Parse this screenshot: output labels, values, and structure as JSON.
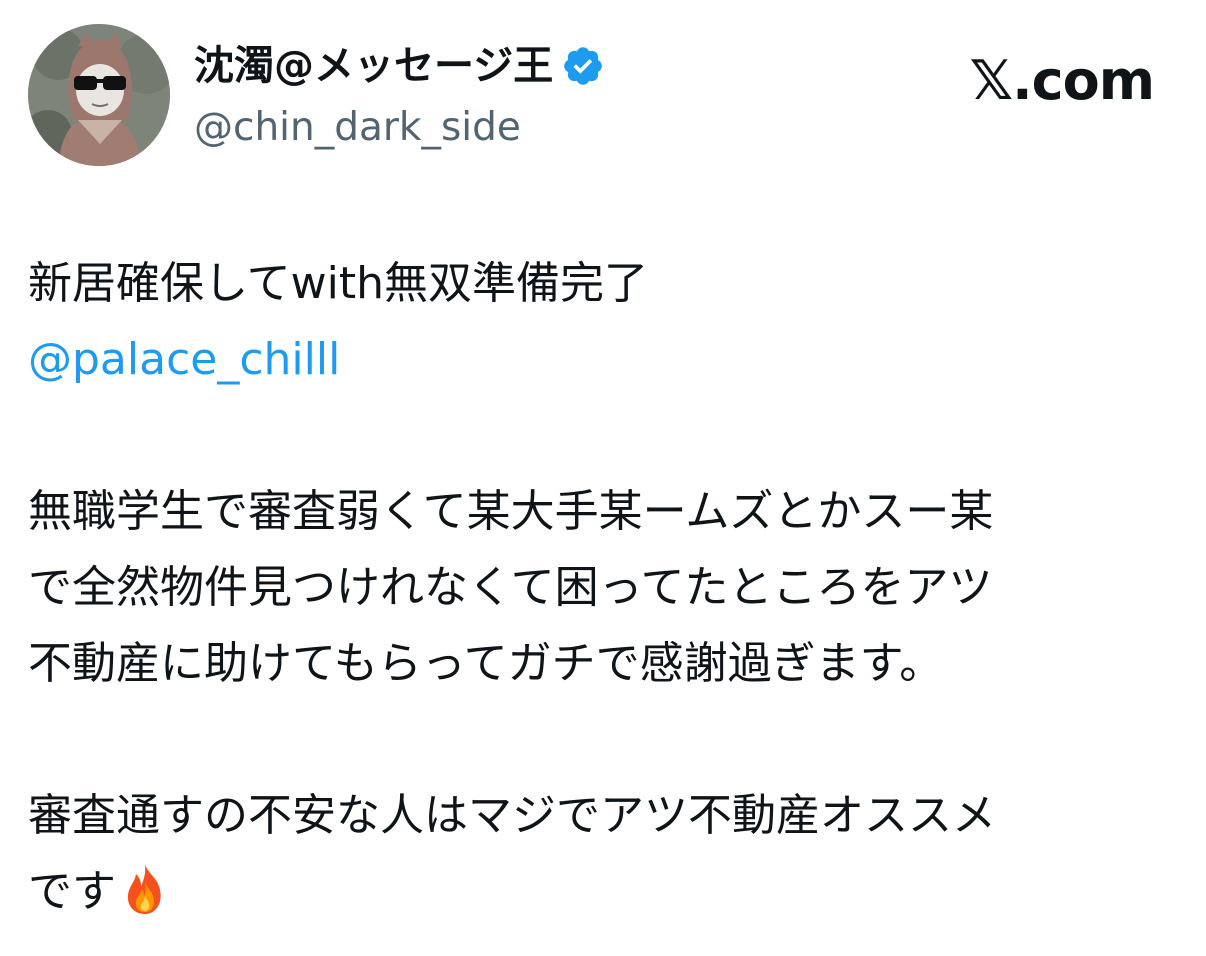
{
  "author": {
    "display_name": "沈濁@メッセージ王",
    "handle": "@chin_dark_side",
    "verified": true,
    "avatar_icon": "sunglasses-character-avatar"
  },
  "brand": {
    "label": "𝕏.com"
  },
  "tweet": {
    "line1": "新居確保してwith無双準備完了",
    "mention": "@palace_chilll",
    "line3": "無職学生で審査弱くて某大手某ームズとかスー某",
    "line4": "で全然物件見つけれなくて困ってたところをアツ",
    "line5": "不動産に助けてもらってガチで感謝過ぎます。",
    "line6": "審査通すの不安な人はマジでアツ不動産オススメ",
    "line7": "です",
    "emoji_icon": "fire-icon"
  },
  "colors": {
    "text": "#0f1419",
    "secondary": "#536471",
    "link": "#1d9bf0",
    "verified": "#1d9bf0"
  }
}
